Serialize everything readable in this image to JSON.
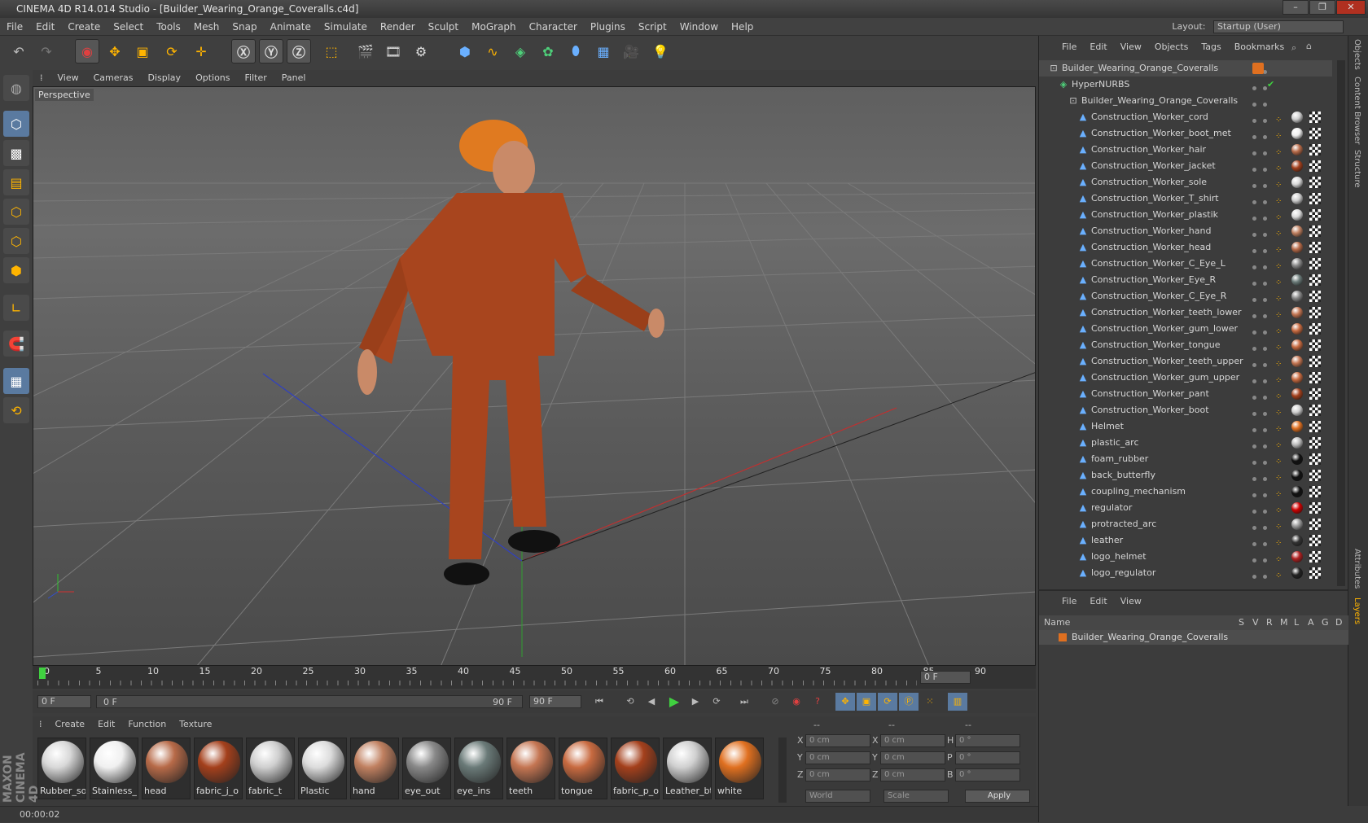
{
  "window": {
    "title": "CINEMA 4D R14.014 Studio - [Builder_Wearing_Orange_Coveralls.c4d]"
  },
  "menubar": [
    "File",
    "Edit",
    "Create",
    "Select",
    "Tools",
    "Mesh",
    "Snap",
    "Animate",
    "Simulate",
    "Render",
    "Sculpt",
    "MoGraph",
    "Character",
    "Plugins",
    "Script",
    "Window",
    "Help"
  ],
  "layout": {
    "label": "Layout:",
    "value": "Startup (User)"
  },
  "viewport": {
    "menu": [
      "View",
      "Cameras",
      "Display",
      "Options",
      "Filter",
      "Panel"
    ],
    "label": "Perspective"
  },
  "timeline": {
    "ticks": [
      "0",
      "5",
      "10",
      "15",
      "20",
      "25",
      "30",
      "35",
      "40",
      "45",
      "50",
      "55",
      "60",
      "65",
      "70",
      "75",
      "80",
      "85",
      "90"
    ],
    "current_frame": "0 F",
    "start_field": "0 F",
    "range_start": "0 F",
    "range_end": "90 F",
    "end_field": "90 F"
  },
  "materials": {
    "menu": [
      "Create",
      "Edit",
      "Function",
      "Texture"
    ],
    "items": [
      {
        "name": "Rubber_so",
        "color": "#d8d8d8"
      },
      {
        "name": "Stainless_",
        "color": "#f0f0f0"
      },
      {
        "name": "head",
        "color": "#b76a48"
      },
      {
        "name": "fabric_j_o",
        "color": "#a4401c"
      },
      {
        "name": "fabric_t",
        "color": "#cfcfcf"
      },
      {
        "name": "Plastic",
        "color": "#dcdcdc"
      },
      {
        "name": "hand",
        "color": "#c08060"
      },
      {
        "name": "eye_out",
        "color": "#888888"
      },
      {
        "name": "eye_ins",
        "color": "#6a7a78"
      },
      {
        "name": "teeth",
        "color": "#c47552"
      },
      {
        "name": "tongue",
        "color": "#c86a40"
      },
      {
        "name": "fabric_p_o",
        "color": "#a4401c"
      },
      {
        "name": "Leather_bt",
        "color": "#d0d0d0"
      },
      {
        "name": "white",
        "color": "#e07020"
      }
    ]
  },
  "coords": {
    "headers": [
      "--",
      "--",
      "--"
    ],
    "rows": [
      {
        "a": "X",
        "av": "0 cm",
        "b": "X",
        "bv": "0 cm",
        "c": "H",
        "cv": "0 °"
      },
      {
        "a": "Y",
        "av": "0 cm",
        "b": "Y",
        "bv": "0 cm",
        "c": "P",
        "cv": "0 °"
      },
      {
        "a": "Z",
        "av": "0 cm",
        "b": "Z",
        "bv": "0 cm",
        "c": "B",
        "cv": "0 °"
      }
    ],
    "mode1": "World",
    "mode2": "Scale",
    "apply": "Apply"
  },
  "status": {
    "time": "00:00:02"
  },
  "objects": {
    "menu": [
      "File",
      "Edit",
      "View",
      "Objects",
      "Tags",
      "Bookmarks"
    ],
    "items": [
      {
        "name": "Builder_Wearing_Orange_Coveralls",
        "level": 0,
        "icon": "null-icon",
        "tag": "#e07020"
      },
      {
        "name": "HyperNURBS",
        "level": 1,
        "icon": "hypernurbs-icon",
        "tag": ""
      },
      {
        "name": "Builder_Wearing_Orange_Coveralls",
        "level": 2,
        "icon": "null-icon",
        "tag": ""
      },
      {
        "name": "Construction_Worker_cord",
        "level": 3,
        "icon": "polygon-icon",
        "tag": "#d0d0d0"
      },
      {
        "name": "Construction_Worker_boot_met",
        "level": 3,
        "icon": "polygon-icon",
        "tag": "#f0f0f0"
      },
      {
        "name": "Construction_Worker_hair",
        "level": 3,
        "icon": "polygon-icon",
        "tag": "#b76a48"
      },
      {
        "name": "Construction_Worker_jacket",
        "level": 3,
        "icon": "polygon-icon",
        "tag": "#a4401c"
      },
      {
        "name": "Construction_Worker_sole",
        "level": 3,
        "icon": "polygon-icon",
        "tag": "#d8d8d8"
      },
      {
        "name": "Construction_Worker_T_shirt",
        "level": 3,
        "icon": "polygon-icon",
        "tag": "#cfcfcf"
      },
      {
        "name": "Construction_Worker_plastik",
        "level": 3,
        "icon": "polygon-icon",
        "tag": "#dcdcdc"
      },
      {
        "name": "Construction_Worker_hand",
        "level": 3,
        "icon": "polygon-icon",
        "tag": "#c08060"
      },
      {
        "name": "Construction_Worker_head",
        "level": 3,
        "icon": "polygon-icon",
        "tag": "#b76a48"
      },
      {
        "name": "Construction_Worker_C_Eye_L",
        "level": 3,
        "icon": "polygon-icon",
        "tag": "#888888"
      },
      {
        "name": "Construction_Worker_Eye_R",
        "level": 3,
        "icon": "polygon-icon",
        "tag": "#6a7a78"
      },
      {
        "name": "Construction_Worker_C_Eye_R",
        "level": 3,
        "icon": "polygon-icon",
        "tag": "#888888"
      },
      {
        "name": "Construction_Worker_teeth_lower",
        "level": 3,
        "icon": "polygon-icon",
        "tag": "#c47552"
      },
      {
        "name": "Construction_Worker_gum_lower",
        "level": 3,
        "icon": "polygon-icon",
        "tag": "#c86a40"
      },
      {
        "name": "Construction_Worker_tongue",
        "level": 3,
        "icon": "polygon-icon",
        "tag": "#c86a40"
      },
      {
        "name": "Construction_Worker_teeth_upper",
        "level": 3,
        "icon": "polygon-icon",
        "tag": "#c47552"
      },
      {
        "name": "Construction_Worker_gum_upper",
        "level": 3,
        "icon": "polygon-icon",
        "tag": "#c86a40"
      },
      {
        "name": "Construction_Worker_pant",
        "level": 3,
        "icon": "polygon-icon",
        "tag": "#a4401c"
      },
      {
        "name": "Construction_Worker_boot",
        "level": 3,
        "icon": "polygon-icon",
        "tag": "#d0d0d0"
      },
      {
        "name": "Helmet",
        "level": 3,
        "icon": "polygon-icon",
        "tag": "#e07020"
      },
      {
        "name": "plastic_arc",
        "level": 3,
        "icon": "polygon-icon",
        "tag": "#bbbbbb"
      },
      {
        "name": "foam_rubber",
        "level": 3,
        "icon": "polygon-icon",
        "tag": "#111111"
      },
      {
        "name": "back_butterfly",
        "level": 3,
        "icon": "polygon-icon",
        "tag": "#111111"
      },
      {
        "name": "coupling_mechanism",
        "level": 3,
        "icon": "polygon-icon",
        "tag": "#111111"
      },
      {
        "name": "regulator",
        "level": 3,
        "icon": "polygon-icon",
        "tag": "#d00000"
      },
      {
        "name": "protracted_arc",
        "level": 3,
        "icon": "polygon-icon",
        "tag": "#999999"
      },
      {
        "name": "leather",
        "level": 3,
        "icon": "polygon-icon",
        "tag": "#333333"
      },
      {
        "name": "logo_helmet",
        "level": 3,
        "icon": "polygon-icon",
        "tag": "#b02020"
      },
      {
        "name": "logo_regulator",
        "level": 3,
        "icon": "polygon-icon",
        "tag": "#222222"
      }
    ]
  },
  "layers": {
    "menu": [
      "File",
      "Edit",
      "View"
    ],
    "headers": [
      "Name",
      "S",
      "V",
      "R",
      "M",
      "L",
      "A",
      "G",
      "D"
    ],
    "row": "Builder_Wearing_Orange_Coveralls"
  },
  "sidetabs": [
    "Objects",
    "Content Browser",
    "Structure",
    "Attributes",
    "Layers"
  ],
  "brand": "MAXON CINEMA 4D"
}
